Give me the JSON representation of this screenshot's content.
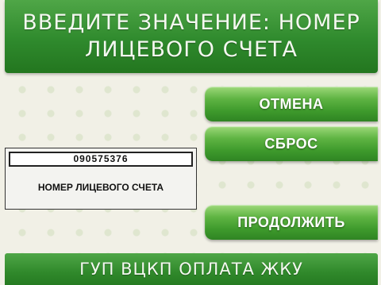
{
  "header": {
    "line1": "ВВЕДИТЕ ЗНАЧЕНИЕ: НОМЕР",
    "line2": "ЛИЦЕВОГО СЧЕТА"
  },
  "buttons": {
    "cancel": "ОТМЕНА",
    "reset": "СБРОС",
    "continue": "ПРОДОЛЖИТЬ"
  },
  "input": {
    "value": "090575376",
    "label": "НОМЕР ЛИЦЕВОГО СЧЕТА"
  },
  "footer": {
    "text": "ГУП ВЦКП ОПЛАТА ЖКУ"
  },
  "colors": {
    "brand_green": "#2f8a2d",
    "button_green": "#5fb443",
    "background": "#f1f0e6"
  }
}
